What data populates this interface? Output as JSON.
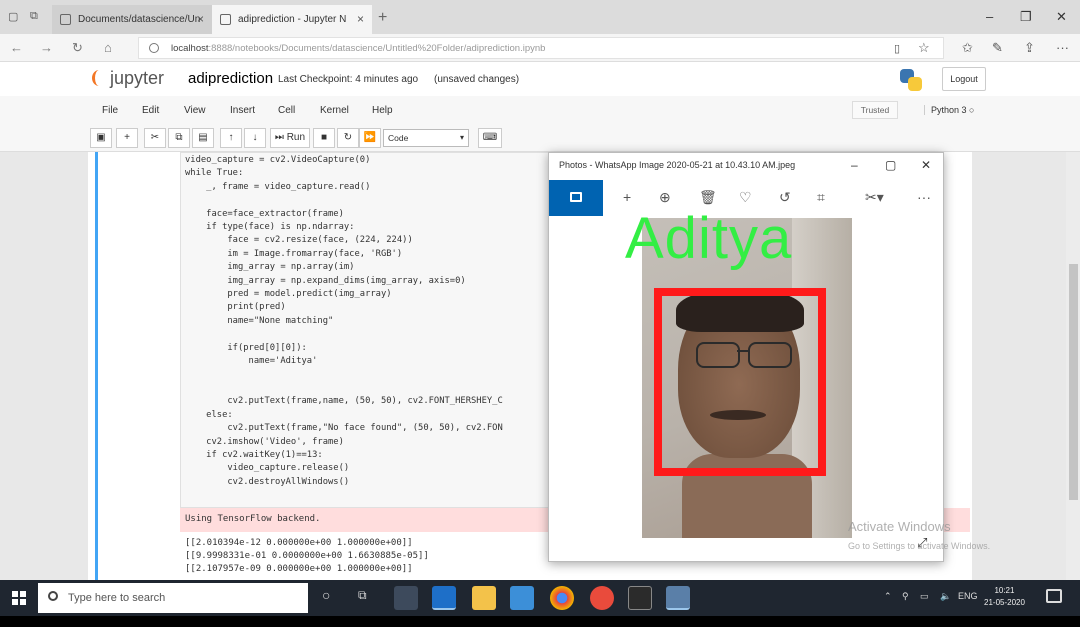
{
  "browser": {
    "tabs": [
      {
        "label": "Documents/datascience/Un"
      },
      {
        "label": "adiprediction - Jupyter N"
      }
    ],
    "url_host": "localhost",
    "url_path": ":8888/notebooks/Documents/datascience/Untitled%20Folder/adiprediction.ipynb"
  },
  "jupyter": {
    "logo_text": "jupyter",
    "notebook_name": "adiprediction",
    "checkpoint": "Last Checkpoint: 4 minutes ago",
    "unsaved": "(unsaved changes)",
    "logout_label": "Logout",
    "menu": [
      "File",
      "Edit",
      "View",
      "Insert",
      "Cell",
      "Kernel",
      "Help"
    ],
    "trusted_label": "Trusted",
    "kernel_label": "Python 3",
    "run_label": "Run",
    "cell_type": "Code"
  },
  "code_lines": [
    "video_capture = cv2.VideoCapture(0)",
    "while True:",
    "    _, frame = video_capture.read()",
    "",
    "    face=face_extractor(frame)",
    "    if type(face) is np.ndarray:",
    "        face = cv2.resize(face, (224, 224))",
    "        im = Image.fromarray(face, 'RGB')",
    "        img_array = np.array(im)",
    "        img_array = np.expand_dims(img_array, axis=0)",
    "        pred = model.predict(img_array)",
    "        print(pred)",
    "        name=\"None matching\"",
    "",
    "        if(pred[0][0]):",
    "            name='Aditya'",
    "",
    "",
    "        cv2.putText(frame,name, (50, 50), cv2.FONT_HERSHEY_C",
    "    else:",
    "        cv2.putText(frame,\"No face found\", (50, 50), cv2.FON",
    "    cv2.imshow('Video', frame)",
    "    if cv2.waitKey(1)==13:",
    "        video_capture.release()",
    "        cv2.destroyAllWindows()"
  ],
  "stderr_text": "Using TensorFlow backend.",
  "output_lines": [
    "[[2.010394e-12 0.000000e+00 1.000000e+00]]",
    "[[9.9998331e-01 0.0000000e+00 1.6630885e-05]]",
    "[[2.107957e-09 0.000000e+00 1.000000e+00]]"
  ],
  "photos": {
    "title": "Photos - WhatsApp Image 2020-05-21 at 10.43.10 AM.jpeg",
    "label_text": "Aditya",
    "label_color": "#33ee44",
    "box_color": "#ff1a1a"
  },
  "watermark": {
    "line1": "Activate Windows",
    "line2": "Go to Settings to activate Windows."
  },
  "taskbar": {
    "search_placeholder": "Type here to search",
    "lang": "ENG",
    "time": "10:21",
    "date": "21-05-2020"
  }
}
